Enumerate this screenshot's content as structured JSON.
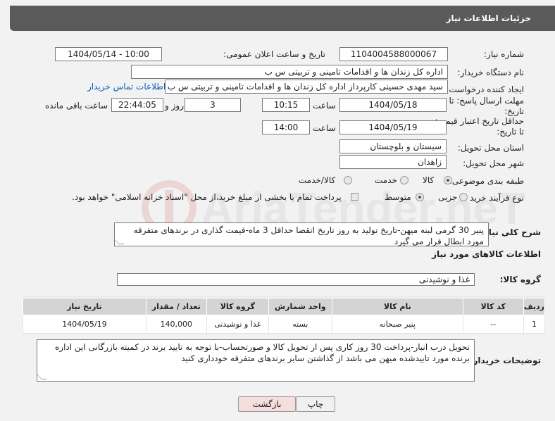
{
  "header": {
    "title": "جزئیات اطلاعات نیاز"
  },
  "form": {
    "need_number_label": "شماره نیاز:",
    "need_number": "1104004588000067",
    "announce_label": "تاریخ و ساعت اعلان عمومی:",
    "announce_value": "1404/05/14 - 10:00",
    "buyer_org_label": "نام دستگاه خریدار:",
    "buyer_org": "اداره کل زندان ها و اقدامات تامینی و تربیتی س ب",
    "creator_label": "ایجاد کننده درخواست:",
    "creator": "سید مهدی حسینی کارپرداز اداره کل زندان ها و اقدامات تامینی و تربیتی س ب",
    "contact_link": "اطلاعات تماس خریدار",
    "deadline_label_1": "مهلت ارسال پاسخ: تا",
    "deadline_label_2": "تاریخ:",
    "deadline_date": "1404/05/18",
    "time_label": "ساعت",
    "deadline_time": "10:15",
    "days_value": "3",
    "days_label": "روز و",
    "remaining_value": "22:44:05",
    "remaining_label": "ساعت باقی مانده",
    "price_label_1": "حداقل تاریخ اعتبار قیمت:",
    "price_label_2": "تا تاریخ:",
    "price_date": "1404/05/19",
    "price_time": "14:00",
    "province_label": "استان محل تحویل:",
    "province": "سیستان و بلوچستان",
    "city_label": "شهر محل تحویل:",
    "city": "زاهدان",
    "category_label": "طبقه بندی موضوعی:",
    "cat_goods": "کالا",
    "cat_service": "خدمت",
    "cat_both": "کالا/خدمت",
    "process_label": "نوع فرآیند خرید :",
    "proc_partial": "جزیی",
    "proc_medium": "متوسط",
    "payment_note": "پرداخت تمام یا بخشی از مبلغ خرید،از محل \"اسناد خزانه اسلامی\" خواهد بود."
  },
  "description": {
    "label": "شرح کلی نیاز:",
    "text": "پنیر 30 گرمی لبنه میهن-تاریخ تولید به روز تاریخ انقضا حداقل 3 ماه-قیمت گذاری در برندهای متفرقه مورد ابطال قرار می گیرد"
  },
  "goods": {
    "section_title": "اطلاعات کالاهای مورد نیاز",
    "group_label": "گروه کالا:",
    "group_value": "غذا و نوشیدنی",
    "columns": [
      "ردیف",
      "کد کالا",
      "نام کالا",
      "واحد شمارش",
      "گروه کالا",
      "تعداد / مقدار",
      "تاریخ نیاز"
    ],
    "rows": [
      [
        "1",
        "--",
        "پنیر صبحانه",
        "بسته",
        "غذا و نوشیدنی",
        "140,000",
        "1404/05/19"
      ]
    ]
  },
  "buyer_notes": {
    "label": "توضیحات خریدار:",
    "text": "تحویل درب انبار-پرداخت 30 روز کاری پس از تحویل کالا و صورتحساب-با توجه به تایید برند در کمیته بازرگانی این اداره برنده مورد تاییدشده میهن می باشد از گذاشتن سایر برندهای متفرقه خودداری کنید"
  },
  "buttons": {
    "back": "بازگشت",
    "print": "چاپ"
  },
  "watermark": {
    "text": "AriaTender.neT"
  }
}
